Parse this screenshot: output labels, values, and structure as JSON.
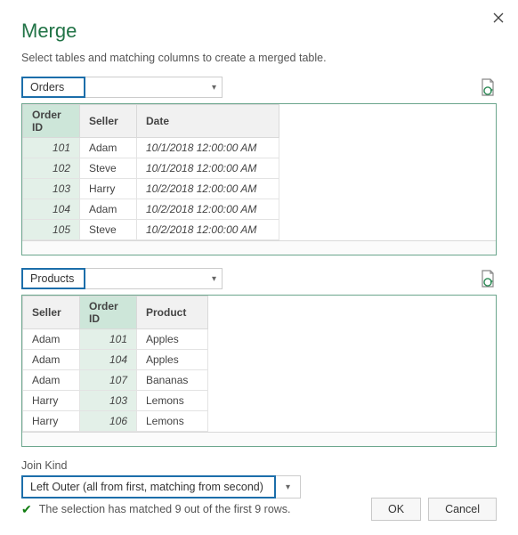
{
  "title": "Merge",
  "subtitle": "Select tables and matching columns to create a merged table.",
  "table1": {
    "name": "Orders",
    "cols": [
      "Order ID",
      "Seller",
      "Date"
    ],
    "rows": [
      {
        "id": "101",
        "seller": "Adam",
        "date": "10/1/2018 12:00:00 AM"
      },
      {
        "id": "102",
        "seller": "Steve",
        "date": "10/1/2018 12:00:00 AM"
      },
      {
        "id": "103",
        "seller": "Harry",
        "date": "10/2/2018 12:00:00 AM"
      },
      {
        "id": "104",
        "seller": "Adam",
        "date": "10/2/2018 12:00:00 AM"
      },
      {
        "id": "105",
        "seller": "Steve",
        "date": "10/2/2018 12:00:00 AM"
      }
    ]
  },
  "table2": {
    "name": "Products",
    "cols": [
      "Seller",
      "Order ID",
      "Product"
    ],
    "rows": [
      {
        "seller": "Adam",
        "id": "101",
        "product": "Apples"
      },
      {
        "seller": "Adam",
        "id": "104",
        "product": "Apples"
      },
      {
        "seller": "Adam",
        "id": "107",
        "product": "Bananas"
      },
      {
        "seller": "Harry",
        "id": "103",
        "product": "Lemons"
      },
      {
        "seller": "Harry",
        "id": "106",
        "product": "Lemons"
      }
    ]
  },
  "join": {
    "label": "Join Kind",
    "value": "Left Outer (all from first, matching from second)"
  },
  "status": "The selection has matched 9 out of the first 9 rows.",
  "buttons": {
    "ok": "OK",
    "cancel": "Cancel"
  }
}
